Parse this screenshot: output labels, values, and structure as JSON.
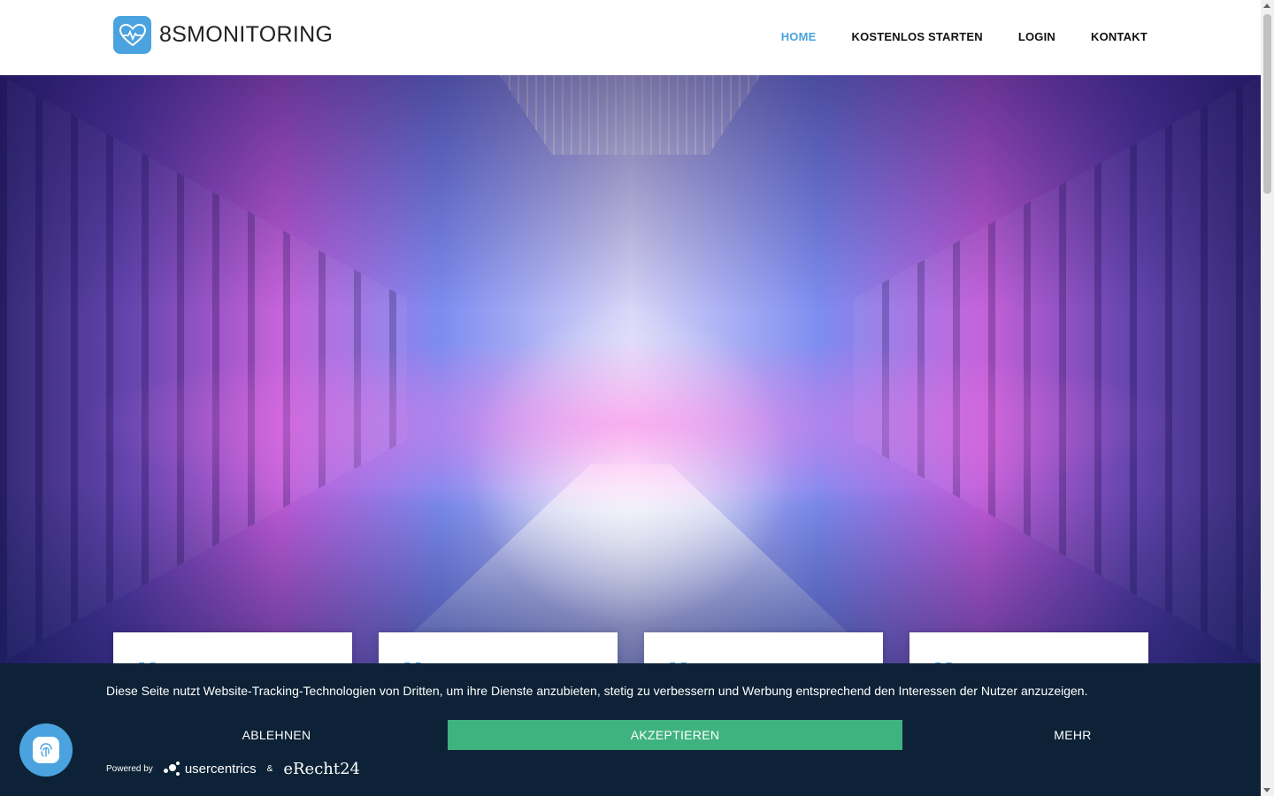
{
  "brand": {
    "name": "8SMONITORING",
    "accent_color": "#4aa3df",
    "logo_icon": "heartbeat-icon"
  },
  "nav": {
    "items": [
      {
        "label": "HOME",
        "active": true
      },
      {
        "label": "KOSTENLOS STARTEN",
        "active": false
      },
      {
        "label": "LOGIN",
        "active": false
      },
      {
        "label": "KONTAKT",
        "active": false
      }
    ]
  },
  "hero": {
    "image": "server-room-corridor"
  },
  "cards": [
    {
      "mark": "[ ]"
    },
    {
      "mark": "[ ]"
    },
    {
      "mark": "[ ]"
    },
    {
      "mark": "[ ]"
    }
  ],
  "cookie_banner": {
    "text": "Diese Seite nutzt Website-Tracking-Technologien von Dritten, um ihre Dienste anzubieten, stetig zu verbessern und Werbung entsprechend den Interessen der Nutzer anzuzeigen.",
    "decline_label": "ABLEHNEN",
    "accept_label": "AKZEPTIEREN",
    "more_label": "MEHR",
    "powered_by": "Powered by",
    "provider1": "usercentrics",
    "ampersand": "&",
    "provider2": "eRecht24",
    "background_color": "#0d2236",
    "accept_color": "#3fb37f"
  },
  "privacy_button": {
    "icon": "fingerprint-icon"
  }
}
